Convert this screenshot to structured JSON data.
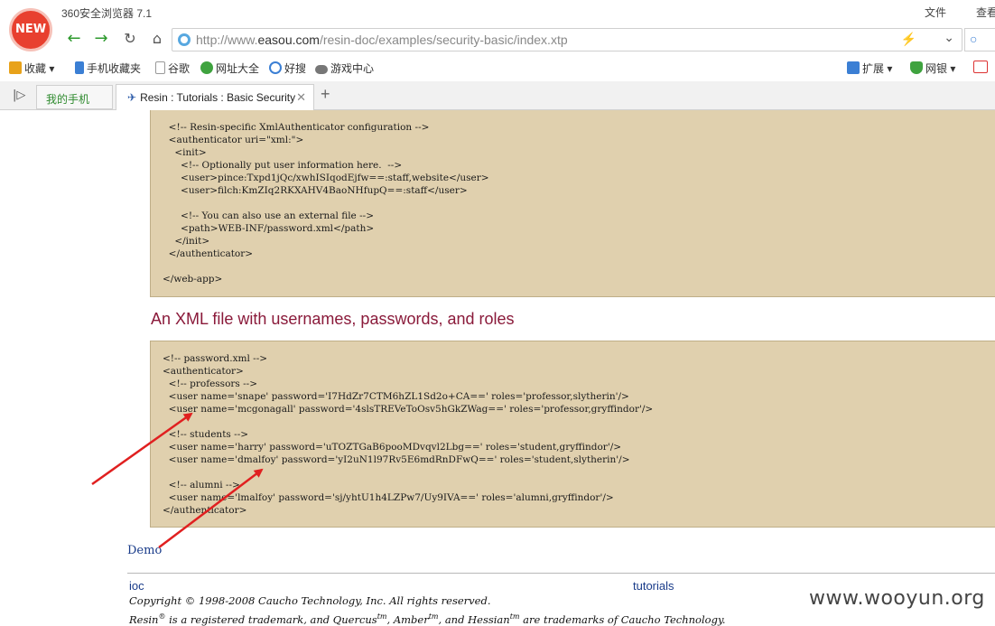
{
  "browser": {
    "logo_text": "NEW",
    "app_title": "360安全浏览器 7.1",
    "menu_file": "文件",
    "menu_view": "查看",
    "url_prefix": "http://www.",
    "url_domain": "easou.com",
    "url_path": "/resin-doc/examples/security-basic/index.xtp"
  },
  "bookmarks": [
    {
      "label": "收藏",
      "icon": "star-icon",
      "color": "#e8a21a"
    },
    {
      "label": "手机收藏夹",
      "icon": "phone-icon",
      "color": "#3b7fd4"
    },
    {
      "label": "谷歌",
      "icon": "page-icon",
      "color": "#999999"
    },
    {
      "label": "网址大全",
      "icon": "globe-icon",
      "color": "#3fa33f"
    },
    {
      "label": "好搜",
      "icon": "search-icon",
      "color": "#3b7fd4"
    },
    {
      "label": "游戏中心",
      "icon": "gamepad-icon",
      "color": "#666666"
    },
    {
      "label": "扩展",
      "icon": "extension-icon",
      "color": "#3b7fd4"
    },
    {
      "label": "网银",
      "icon": "shield-icon",
      "color": "#3fa33f"
    }
  ],
  "tabs": {
    "phone_tab": "我的手机",
    "active_tab": "Resin : Tutorials : Basic Security"
  },
  "page": {
    "code1": "  <!-- Resin-specific XmlAuthenticator configuration -->\n  <authenticator uri=\"xml:\">\n    <init>\n      <!-- Optionally put user information here.  -->\n      <user>pince:Txpd1jQc/xwhISIqodEjfw==:staff,website</user>\n      <user>filch:KmZIq2RKXAHV4BaoNHfupQ==:staff</user>\n\n      <!-- You can also use an external file -->\n      <path>WEB-INF/password.xml</path>\n    </init>\n  </authenticator>\n\n</web-app>",
    "section_heading": "An XML file with usernames, passwords, and roles",
    "code2": "<!-- password.xml -->\n<authenticator>\n  <!-- professors -->\n  <user name='snape' password='I7HdZr7CTM6hZL1Sd2o+CA==' roles='professor,slytherin'/>\n  <user name='mcgonagall' password='4slsTREVeToOsv5hGkZWag==' roles='professor,gryffindor'/>\n\n  <!-- students -->\n  <user name='harry' password='uTOZTGaB6pooMDvqvl2Lbg==' roles='student,gryffindor'/>\n  <user name='dmalfoy' password='yI2uN1l97Rv5E6mdRnDFwQ==' roles='student,slytherin'/>\n\n  <!-- alumni -->\n  <user name='lmalfoy' password='sj/yhtU1h4LZPw7/Uy9IVA==' roles='alumni,gryffindor'/>\n</authenticator>",
    "demo_link": "Demo",
    "footer_ioc": "ioc",
    "footer_tutorials": "tutorials",
    "copyright": "Copyright © 1998-2008 Caucho Technology, Inc. All rights reserved.",
    "trademark_1": "Resin",
    "trademark_2": " is a registered trademark, and Quercus",
    "trademark_3": ", Amber",
    "trademark_4": ", and Hessian",
    "trademark_5": " are trademarks of Caucho Technology.",
    "reg_mark": "®",
    "tm_mark": "tm",
    "watermark": "www.wooyun.org"
  },
  "colors": {
    "code_bg": "#e0d0ae",
    "heading": "#8a1a3a",
    "link": "#1a3c8a",
    "arrow": "#e02020"
  }
}
